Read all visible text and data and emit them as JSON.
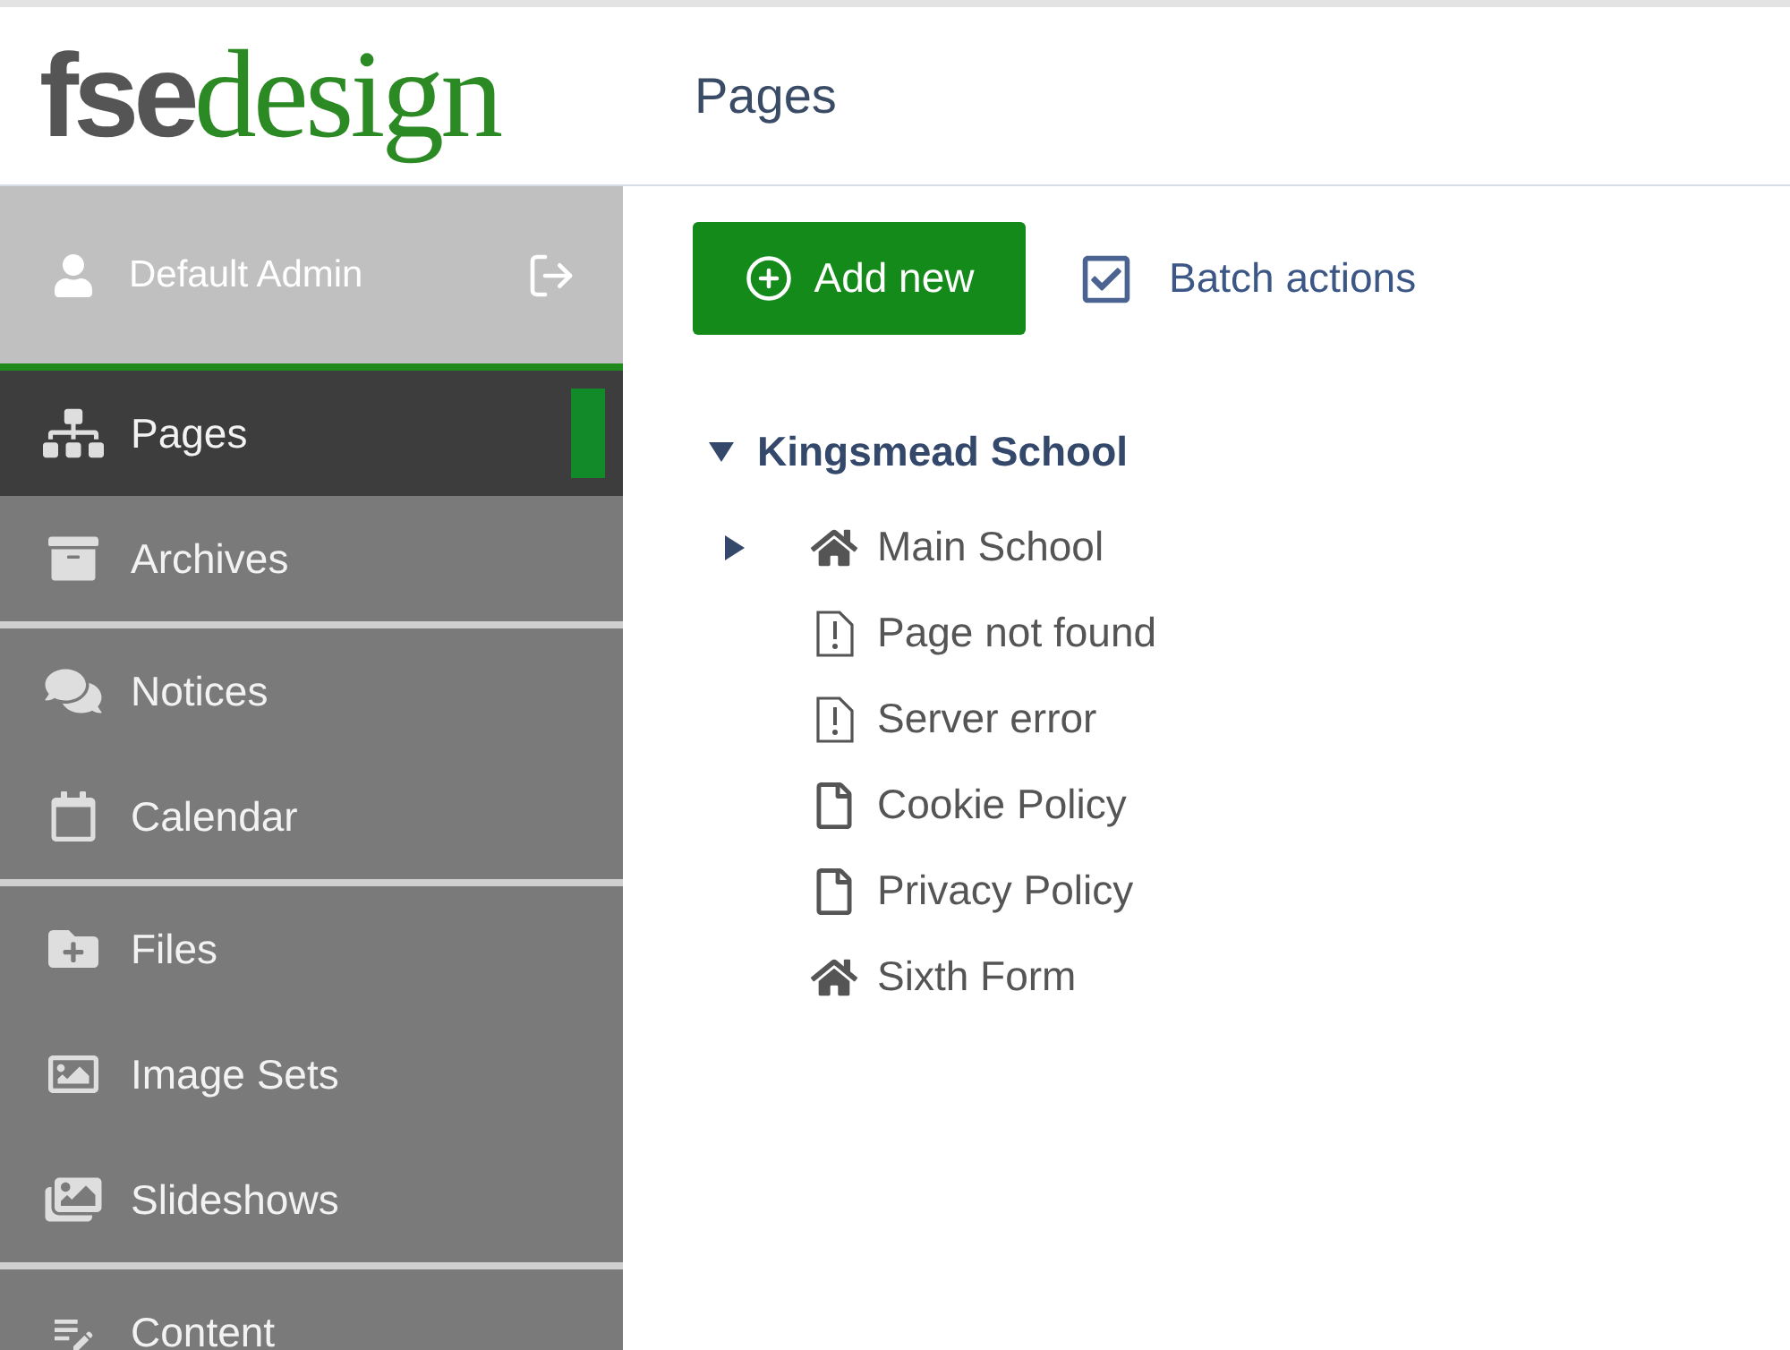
{
  "logo": {
    "part_1": "fse",
    "part_2": "design"
  },
  "header": {
    "title": "Pages"
  },
  "sidebar": {
    "user": {
      "name": "Default Admin"
    },
    "sections": [
      {
        "items": [
          {
            "label": "Pages",
            "selected": true
          },
          {
            "label": "Archives",
            "selected": false
          }
        ]
      },
      {
        "items": [
          {
            "label": "Notices",
            "selected": false
          },
          {
            "label": "Calendar",
            "selected": false
          }
        ]
      },
      {
        "items": [
          {
            "label": "Files",
            "selected": false
          },
          {
            "label": "Image Sets",
            "selected": false
          },
          {
            "label": "Slideshows",
            "selected": false
          }
        ]
      },
      {
        "items": [
          {
            "label": "Content",
            "selected": false
          }
        ]
      }
    ]
  },
  "toolbar": {
    "add_button": "Add new",
    "batch_button": "Batch actions"
  },
  "tree": {
    "label": "Kingsmead School",
    "expanded": true,
    "children": [
      {
        "label": "Main School",
        "kind": "home",
        "expanded": false
      },
      {
        "label": "Page not found",
        "kind": "error"
      },
      {
        "label": "Server error",
        "kind": "error"
      },
      {
        "label": "Cookie Policy",
        "kind": "page"
      },
      {
        "label": "Privacy Policy",
        "kind": "page"
      },
      {
        "label": "Sixth Form",
        "kind": "home"
      }
    ]
  }
}
